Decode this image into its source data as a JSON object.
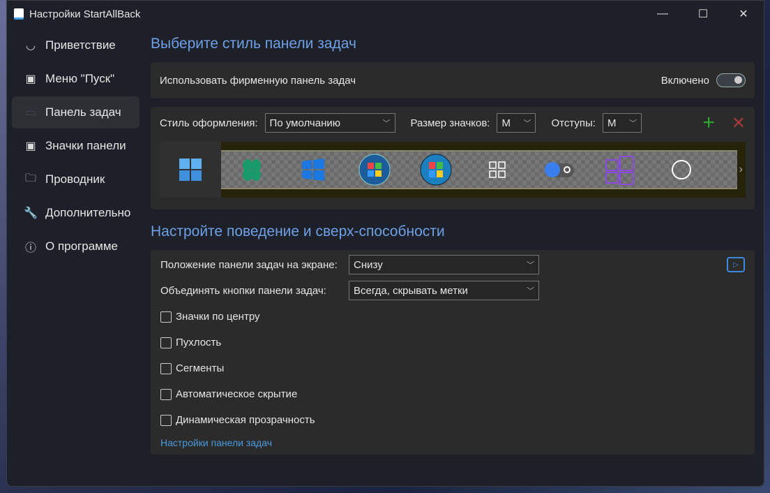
{
  "window": {
    "title": "Настройки StartAllBack",
    "minimize": "—",
    "maximize": "☐",
    "close": "✕"
  },
  "sidebar": {
    "items": [
      {
        "label": "Приветствие",
        "icon": "smile-icon",
        "glyph": "◡"
      },
      {
        "label": "Меню \"Пуск\"",
        "icon": "start-menu-icon",
        "glyph": "▣"
      },
      {
        "label": "Панель задач",
        "icon": "taskbar-icon",
        "glyph": "▭"
      },
      {
        "label": "Значки панели",
        "icon": "tray-icon",
        "glyph": "▣"
      },
      {
        "label": "Проводник",
        "icon": "folder-icon",
        "glyph": "🗀"
      },
      {
        "label": "Дополнительно",
        "icon": "wrench-icon",
        "glyph": "🔧"
      },
      {
        "label": "О программе",
        "icon": "info-icon",
        "glyph": "ⓘ"
      }
    ],
    "active": 2
  },
  "section1": {
    "title": "Выберите стиль панели задач",
    "use_label": "Использовать фирменную панель задач",
    "toggle_label": "Включено",
    "toggle_on": true,
    "style_label": "Стиль оформления:",
    "style_value": "По умолчанию",
    "size_label": "Размер значков:",
    "size_value": "M",
    "padding_label": "Отступы:",
    "padding_value": "M",
    "add": "+",
    "remove": "✕"
  },
  "section2": {
    "title": "Настройте поведение и сверх-способности",
    "position_label": "Положение панели задач на экране:",
    "position_value": "Снизу",
    "combine_label": "Объединять кнопки панели задач:",
    "combine_value": "Всегда, скрывать метки",
    "checkboxes": [
      {
        "label": "Значки по центру",
        "checked": false
      },
      {
        "label": "Пухлость",
        "checked": false
      },
      {
        "label": "Сегменты",
        "checked": false
      },
      {
        "label": "Автоматическое скрытие",
        "checked": false
      },
      {
        "label": "Динамическая прозрачность",
        "checked": false
      }
    ],
    "link": "Настройки панели задач"
  },
  "colors": {
    "accent": "#6ea0e6",
    "link": "#4a9ae0",
    "add": "#2fa82f",
    "remove": "#a33a3a"
  }
}
